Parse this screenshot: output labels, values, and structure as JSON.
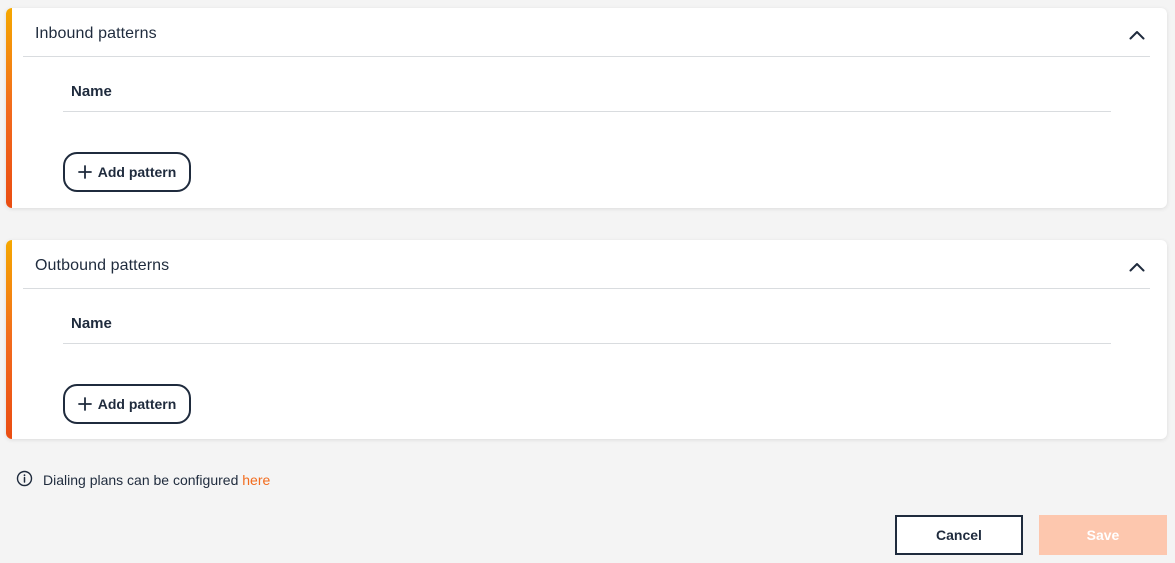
{
  "inbound": {
    "title": "Inbound patterns",
    "column_name": "Name",
    "add_button_label": "Add pattern",
    "toggle_icon": "chevron-up-icon"
  },
  "outbound": {
    "title": "Outbound patterns",
    "column_name": "Name",
    "add_button_label": "Add pattern",
    "toggle_icon": "chevron-up-icon"
  },
  "info": {
    "icon": "info-icon",
    "text": "Dialing plans can be configured",
    "link_text": "here"
  },
  "footer": {
    "cancel_label": "Cancel",
    "save_label": "Save"
  },
  "colors": {
    "accent": "#f26b1d",
    "accent_gradient_top": "#f5a800",
    "text": "#1f2b3d",
    "save_disabled": "#fdc7ae"
  }
}
